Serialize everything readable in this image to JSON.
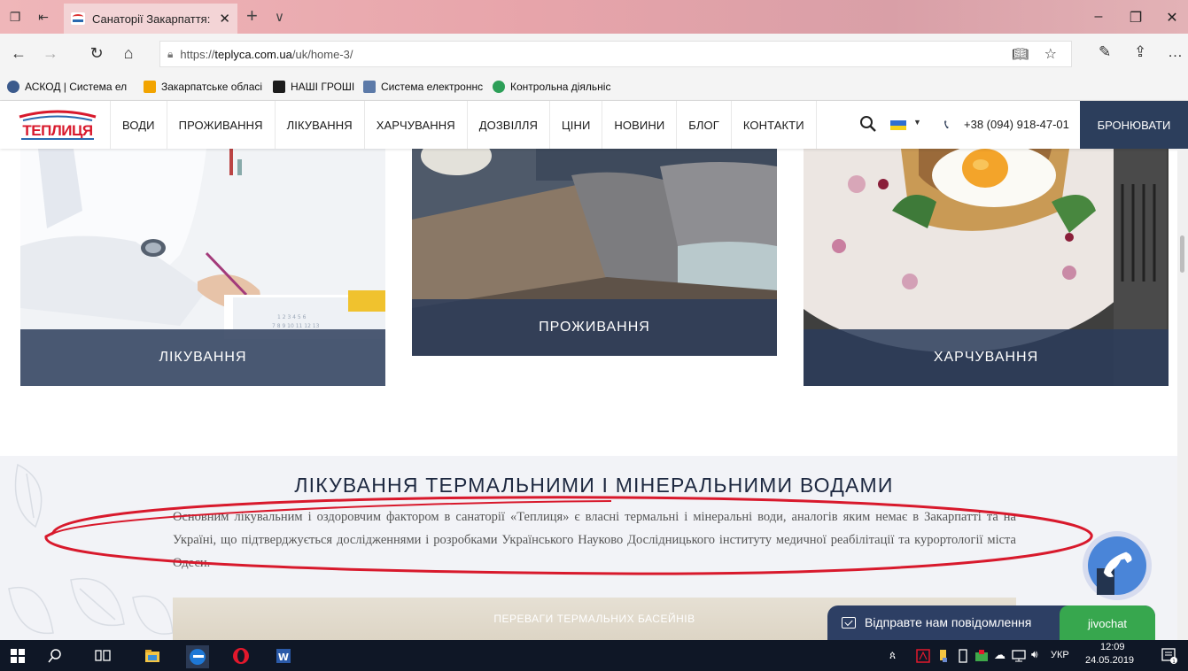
{
  "browser": {
    "tab_title": "Санаторії Закарпаття: (",
    "tab_close": "✕",
    "new_tab": "+",
    "tab_menu": "∨",
    "url_prefix": "https://",
    "url_host": "teplyca.com.ua",
    "url_path": "/uk/home-3/",
    "favorites": [
      {
        "label": "АСКОД | Система ел",
        "icon": "shield-icon",
        "color": "#3b5a8c"
      },
      {
        "label": "Закарпатське обласі",
        "icon": "orange-square-icon",
        "color": "#f2a400"
      },
      {
        "label": "НАШІ ГРОШІ",
        "icon": "nashi-groshi-icon",
        "color": "#1c1c1c"
      },
      {
        "label": "Система електроннс",
        "icon": "document-icon",
        "color": "#5c7aa8"
      },
      {
        "label": "Контрольна діяльніс",
        "icon": "leaf-icon",
        "color": "#2d9f58"
      }
    ]
  },
  "site": {
    "nav": [
      "ВОДИ",
      "ПРОЖИВАННЯ",
      "ЛІКУВАННЯ",
      "ХАРЧУВАННЯ",
      "ДОЗВІЛЛЯ",
      "ЦІНИ",
      "НОВИНИ",
      "БЛОГ",
      "КОНТАКТИ"
    ],
    "phone": "+38 (094) 918-47-01",
    "book_button": "БРОНЮВАТИ",
    "cards": [
      "ЛІКУВАННЯ",
      "ПРОЖИВАННЯ",
      "ХАРЧУВАННЯ"
    ],
    "section_title": "ЛІКУВАННЯ ТЕРМАЛЬНИМИ І МІНЕРАЛЬНИМИ ВОДАМИ",
    "section_text": "Основним лікувальним і оздоровчим фактором в санаторії «Теплиця» є власні термальні і мінеральні води, аналогів яким немає в Закарпатті та на Україні, що підтверджується дослідженнями і розробками Українського Науково Дослідницького інституту медичної реабілітації та курортології міста Одеси.",
    "tab_strip_label": "ПЕРЕВАГИ ТЕРМАЛЬНИХ БАСЕЙНІВ"
  },
  "chat": {
    "prompt": "Відправте нам повідомлення",
    "brand": "jivochat"
  },
  "taskbar": {
    "language": "УКР",
    "time": "12:09",
    "date": "24.05.2019"
  },
  "colors": {
    "brand_navy": "#2c3e5c",
    "chat_green": "#37a74e",
    "annotation_red": "#d8192c"
  }
}
